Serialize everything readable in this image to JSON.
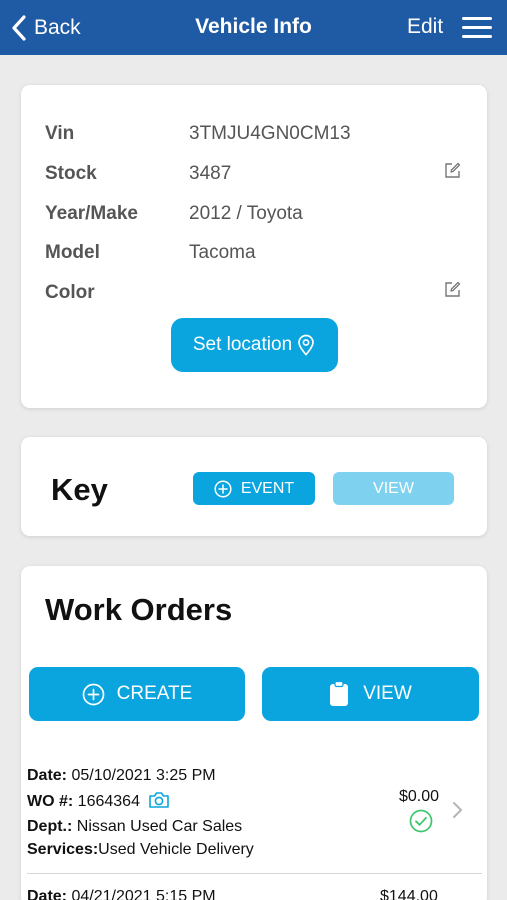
{
  "nav": {
    "back_label": "Back",
    "title": "Vehicle Info",
    "edit_label": "Edit"
  },
  "vehicle": {
    "vin_label": "Vin",
    "vin_value": "3TMJU4GN0CM13",
    "stock_label": "Stock",
    "stock_value": "3487",
    "year_make_label": "Year/Make",
    "year_make_value": "2012 / Toyota",
    "model_label": "Model",
    "model_value": "Tacoma",
    "color_label": "Color",
    "color_value": "",
    "set_location_label": "Set location"
  },
  "key": {
    "title": "Key",
    "event_label": "EVENT",
    "view_label": "VIEW"
  },
  "work_orders": {
    "title": "Work Orders",
    "create_label": "CREATE",
    "view_label": "VIEW",
    "date_label": "Date:",
    "wo_label": "WO #:",
    "dept_label": "Dept.:",
    "services_label": "Services:",
    "items": [
      {
        "date": "05/10/2021 3:25 PM",
        "wo_number": "1664364",
        "dept": "Nissan Used Car Sales",
        "services": "Used Vehicle Delivery",
        "amount": "$0.00",
        "status": "complete"
      },
      {
        "date": "04/21/2021 5:15 PM",
        "amount": "$144.00"
      }
    ]
  },
  "colors": {
    "nav_bg": "#1f5aa5",
    "accent": "#0aa5df",
    "accent_light": "#7fd2ef",
    "check_green": "#3cc76a"
  },
  "icons": {
    "back": "chevron-left-icon",
    "menu": "hamburger-menu-icon",
    "edit": "edit-pencil-icon",
    "location": "map-pin-icon",
    "add": "plus-circle-icon",
    "clipboard": "clipboard-icon",
    "camera": "camera-icon",
    "check": "check-circle-icon",
    "chevron": "chevron-right-icon"
  }
}
